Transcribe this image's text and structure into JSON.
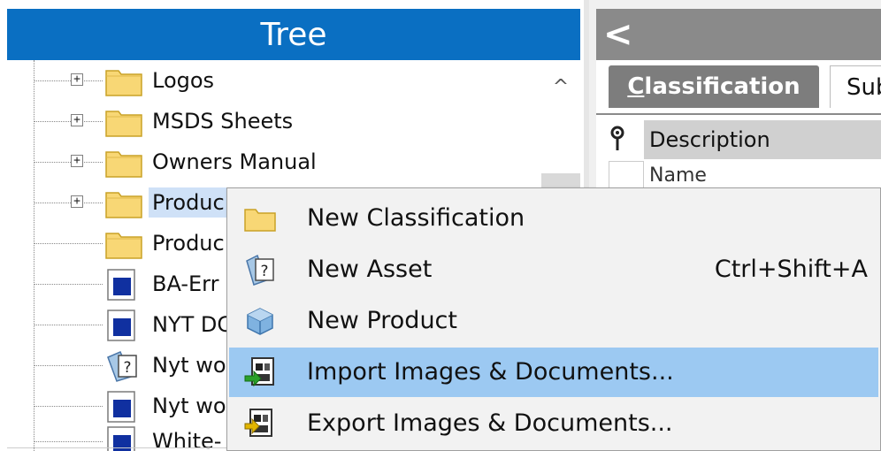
{
  "tree": {
    "title": "Tree",
    "items": [
      {
        "label": "Logos",
        "expander": "+",
        "icon": "folder-icon"
      },
      {
        "label": "MSDS Sheets",
        "expander": "+",
        "icon": "folder-icon"
      },
      {
        "label": "Owners Manual",
        "expander": "+",
        "icon": "folder-icon"
      },
      {
        "label": "Produc",
        "expander": "+",
        "icon": "folder-icon",
        "selected": true
      },
      {
        "label": "Produc",
        "icon": "folder-icon"
      },
      {
        "label": "BA-Err",
        "icon": "product-doc-icon"
      },
      {
        "label": "NYT DC",
        "icon": "product-doc-icon"
      },
      {
        "label": "Nyt wo",
        "icon": "asset-icon"
      },
      {
        "label": "Nyt wo",
        "icon": "product-doc-icon"
      },
      {
        "label": "White-",
        "icon": "product-doc-icon"
      }
    ],
    "scroll_up_glyph": "^"
  },
  "right_panel": {
    "back_glyph": "<",
    "tabs": [
      {
        "label_underlined": "C",
        "label_rest": "lassification",
        "active": true
      },
      {
        "label": "Sub",
        "active": false
      }
    ],
    "column_header": "Description",
    "first_cell": "Name"
  },
  "context_menu": {
    "items": [
      {
        "label": "New Classification",
        "shortcut": "",
        "icon": "folder-icon"
      },
      {
        "label": "New Asset",
        "shortcut": "Ctrl+Shift+A",
        "icon": "asset-icon"
      },
      {
        "label": "New Product",
        "shortcut": "",
        "icon": "cube-icon"
      },
      {
        "label": "Import Images & Documents...",
        "shortcut": "",
        "icon": "import-icon",
        "highlighted": true
      },
      {
        "label": "Export Images & Documents...",
        "shortcut": "",
        "icon": "export-icon"
      }
    ]
  },
  "colors": {
    "tree_header": "#0a6fc2",
    "right_header": "#8a8a8a",
    "menu_highlight": "#9cc9f2",
    "selection": "#cfe1f7"
  }
}
